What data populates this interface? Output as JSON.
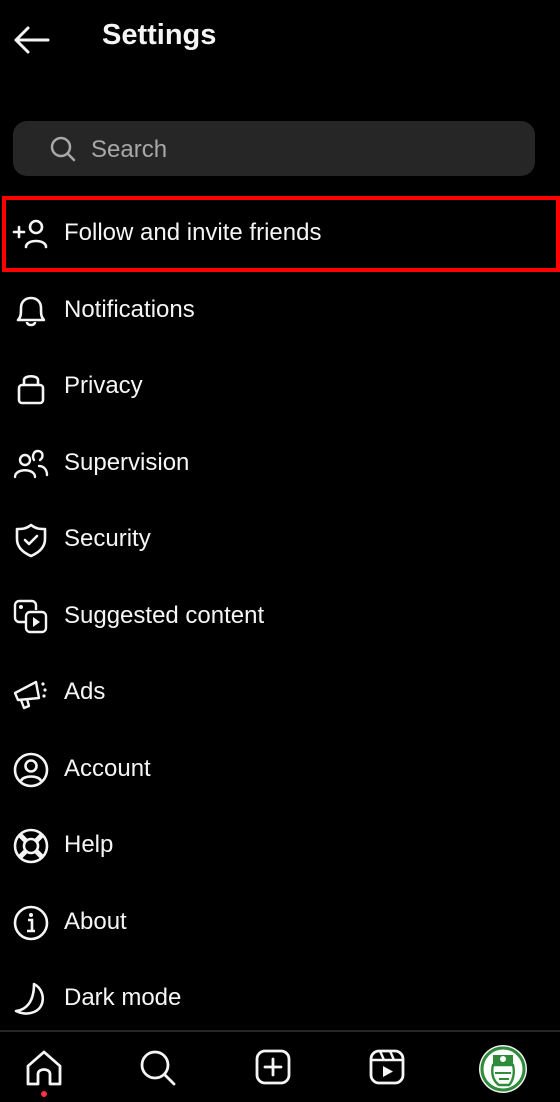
{
  "header": {
    "title": "Settings",
    "back_icon": "arrow-left-icon"
  },
  "search": {
    "placeholder": "Search",
    "value": "",
    "icon": "search-icon"
  },
  "items": [
    {
      "label": "Follow and invite friends",
      "icon": "person-add-icon",
      "highlighted": true
    },
    {
      "label": "Notifications",
      "icon": "bell-icon"
    },
    {
      "label": "Privacy",
      "icon": "lock-icon"
    },
    {
      "label": "Supervision",
      "icon": "people-icon"
    },
    {
      "label": "Security",
      "icon": "shield-check-icon"
    },
    {
      "label": "Suggested content",
      "icon": "media-play-icon"
    },
    {
      "label": "Ads",
      "icon": "megaphone-icon"
    },
    {
      "label": "Account",
      "icon": "user-circle-icon"
    },
    {
      "label": "Help",
      "icon": "lifebuoy-icon"
    },
    {
      "label": "About",
      "icon": "info-icon"
    },
    {
      "label": "Dark mode",
      "icon": "moon-icon"
    }
  ],
  "highlight_color": "#ff0000",
  "bottom_nav": [
    {
      "name": "home",
      "icon": "home-icon",
      "active": true,
      "notification_dot": true
    },
    {
      "name": "search",
      "icon": "search-icon"
    },
    {
      "name": "create",
      "icon": "plus-square-icon"
    },
    {
      "name": "reels",
      "icon": "reels-icon"
    },
    {
      "name": "profile",
      "icon": "avatar"
    }
  ],
  "colors": {
    "background": "#000000",
    "search_bg": "#262626",
    "text": "#f5f5f5",
    "placeholder": "#a8a8a8",
    "dot": "#ff3040",
    "avatar_green": "#2e8b3a"
  }
}
